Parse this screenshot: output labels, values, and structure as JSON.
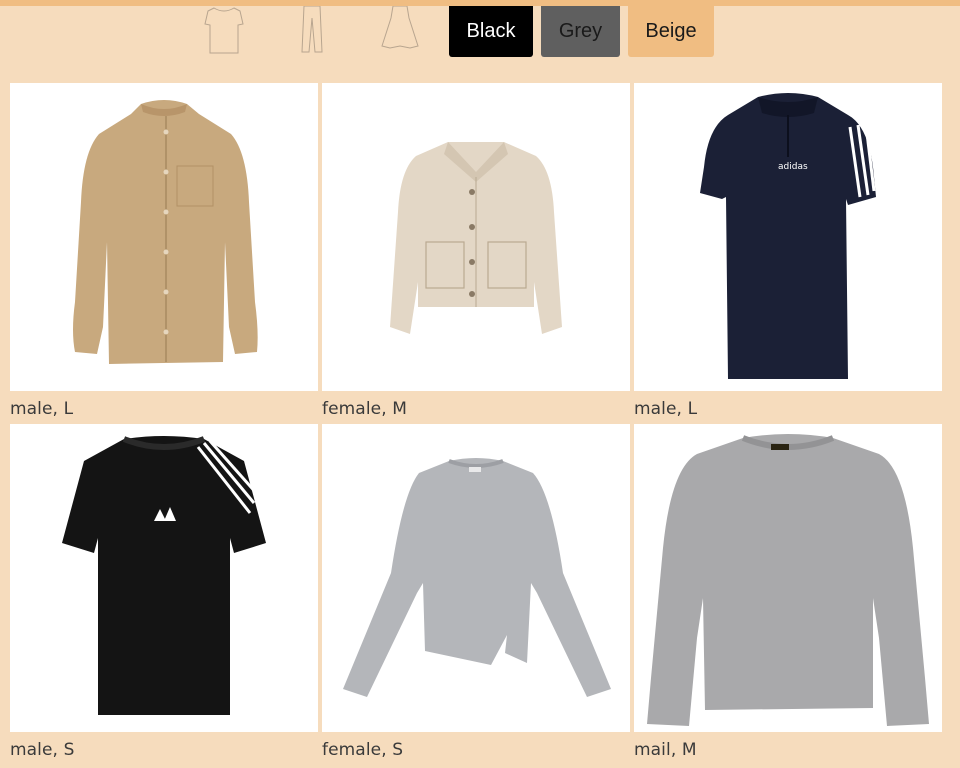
{
  "filters": {
    "type_icons": [
      {
        "name": "tshirt-icon"
      },
      {
        "name": "pants-icon"
      },
      {
        "name": "dress-icon"
      }
    ],
    "colors": [
      {
        "label": "Black",
        "bg": "#000000",
        "fg": "#ffffff"
      },
      {
        "label": "Grey",
        "bg": "#5f5f5f",
        "fg": "#1a1a1a"
      },
      {
        "label": "Beige",
        "bg": "#f0bd82",
        "fg": "#1a1a1a"
      }
    ]
  },
  "products": [
    {
      "caption": "male, L",
      "image": "beige-shirt-image"
    },
    {
      "caption": "female, M",
      "image": "beige-jacket-image"
    },
    {
      "caption": "male, L",
      "image": "navy-polo-image",
      "logo_text": "adidas"
    },
    {
      "caption": "male, S",
      "image": "black-tshirt-image"
    },
    {
      "caption": "female, S",
      "image": "grey-longsleeve-image"
    },
    {
      "caption": "mail, M",
      "image": "grey-sweater-image"
    }
  ]
}
